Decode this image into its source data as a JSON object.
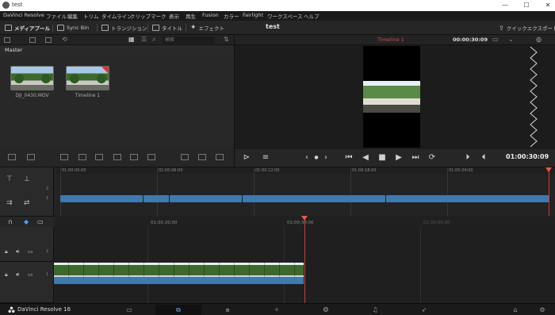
{
  "window": {
    "title": "test",
    "minimize": "—",
    "maximize": "☐",
    "close": "✕"
  },
  "menu": [
    "DaVinci Resolve",
    "ファイル",
    "編集",
    "トリム",
    "タイムライン",
    "クリップ",
    "マーク",
    "表示",
    "再生",
    "Fusion",
    "カラー",
    "Fairlight",
    "ワークスペース",
    "ヘルプ"
  ],
  "toolbar": {
    "media_pool": "メディアプール",
    "sync_bin": "Sync Bin",
    "transitions": "トランジション",
    "titles": "タイトル",
    "effects": "エフェクト",
    "project_title": "test",
    "quick_export": "クイックエクスポート"
  },
  "media_pool": {
    "search_placeholder": "検索",
    "bin_name": "Master",
    "clips": [
      {
        "name": "DJI_0430.MOV"
      },
      {
        "name": "Timeline 1"
      }
    ]
  },
  "viewer": {
    "timeline_name": "Timeline 1",
    "header_timecode": "00:00:30:09",
    "timecode": "01:00:30:09"
  },
  "upper_timeline": {
    "ruler": [
      "01:00:00:00",
      "01:00:06:00",
      "01:00:12:00",
      "01:00:18:00",
      "01:00:24:00"
    ],
    "track_numbers": [
      "2",
      "1"
    ]
  },
  "lower_timeline": {
    "ruler": [
      "01:00:20:00",
      "01:00:30:00",
      "01:00:35:00"
    ],
    "tracks": [
      {
        "number": "2"
      },
      {
        "number": "1"
      }
    ]
  },
  "page_bar": {
    "brand": "DaVinci Resolve 16",
    "active_page": "cut"
  },
  "colors": {
    "accent_red": "#e04848",
    "clip_blue": "#3f79ad",
    "active_page": "#6ab0ff"
  }
}
